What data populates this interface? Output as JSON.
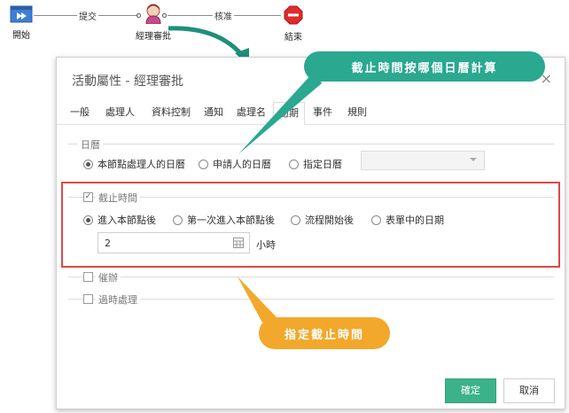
{
  "flow": {
    "start_label": "開始",
    "submit_label": "提交",
    "approver_label": "經理審批",
    "approve_label": "核准",
    "end_label": "結束"
  },
  "dialog": {
    "title": "活動屬性 - 經理審批",
    "close": "×",
    "tabs": [
      "一般",
      "處理人",
      "資料控制",
      "通知",
      "處理名",
      "逾期",
      "事件",
      "規則"
    ],
    "active_tab": "逾期",
    "calendar": {
      "title": "日曆",
      "options": [
        "本節點處理人的日曆",
        "申請人的日曆",
        "指定日曆"
      ],
      "selected": "本節點處理人的日曆",
      "select_value": ""
    },
    "deadline": {
      "title": "截止時間",
      "checked": true,
      "options": [
        "進入本節點後",
        "第一次進入本節點後",
        "流程開始後",
        "表單中的日期"
      ],
      "selected": "進入本節點後",
      "value": "2",
      "unit": "小時"
    },
    "urge": {
      "title": "催辦",
      "checked": false
    },
    "overdue": {
      "title": "過時處理",
      "checked": false
    },
    "ok": "確定",
    "cancel": "取消"
  },
  "callouts": {
    "top": "截止時間按哪個日曆計算",
    "bottom": "指定截止時間"
  },
  "colors": {
    "ok_button": "#3cb28b",
    "callout_top": "#2aa890",
    "callout_bottom": "#f2a82a",
    "highlight_box": "#e04747",
    "end_node": "#e02b2b"
  }
}
